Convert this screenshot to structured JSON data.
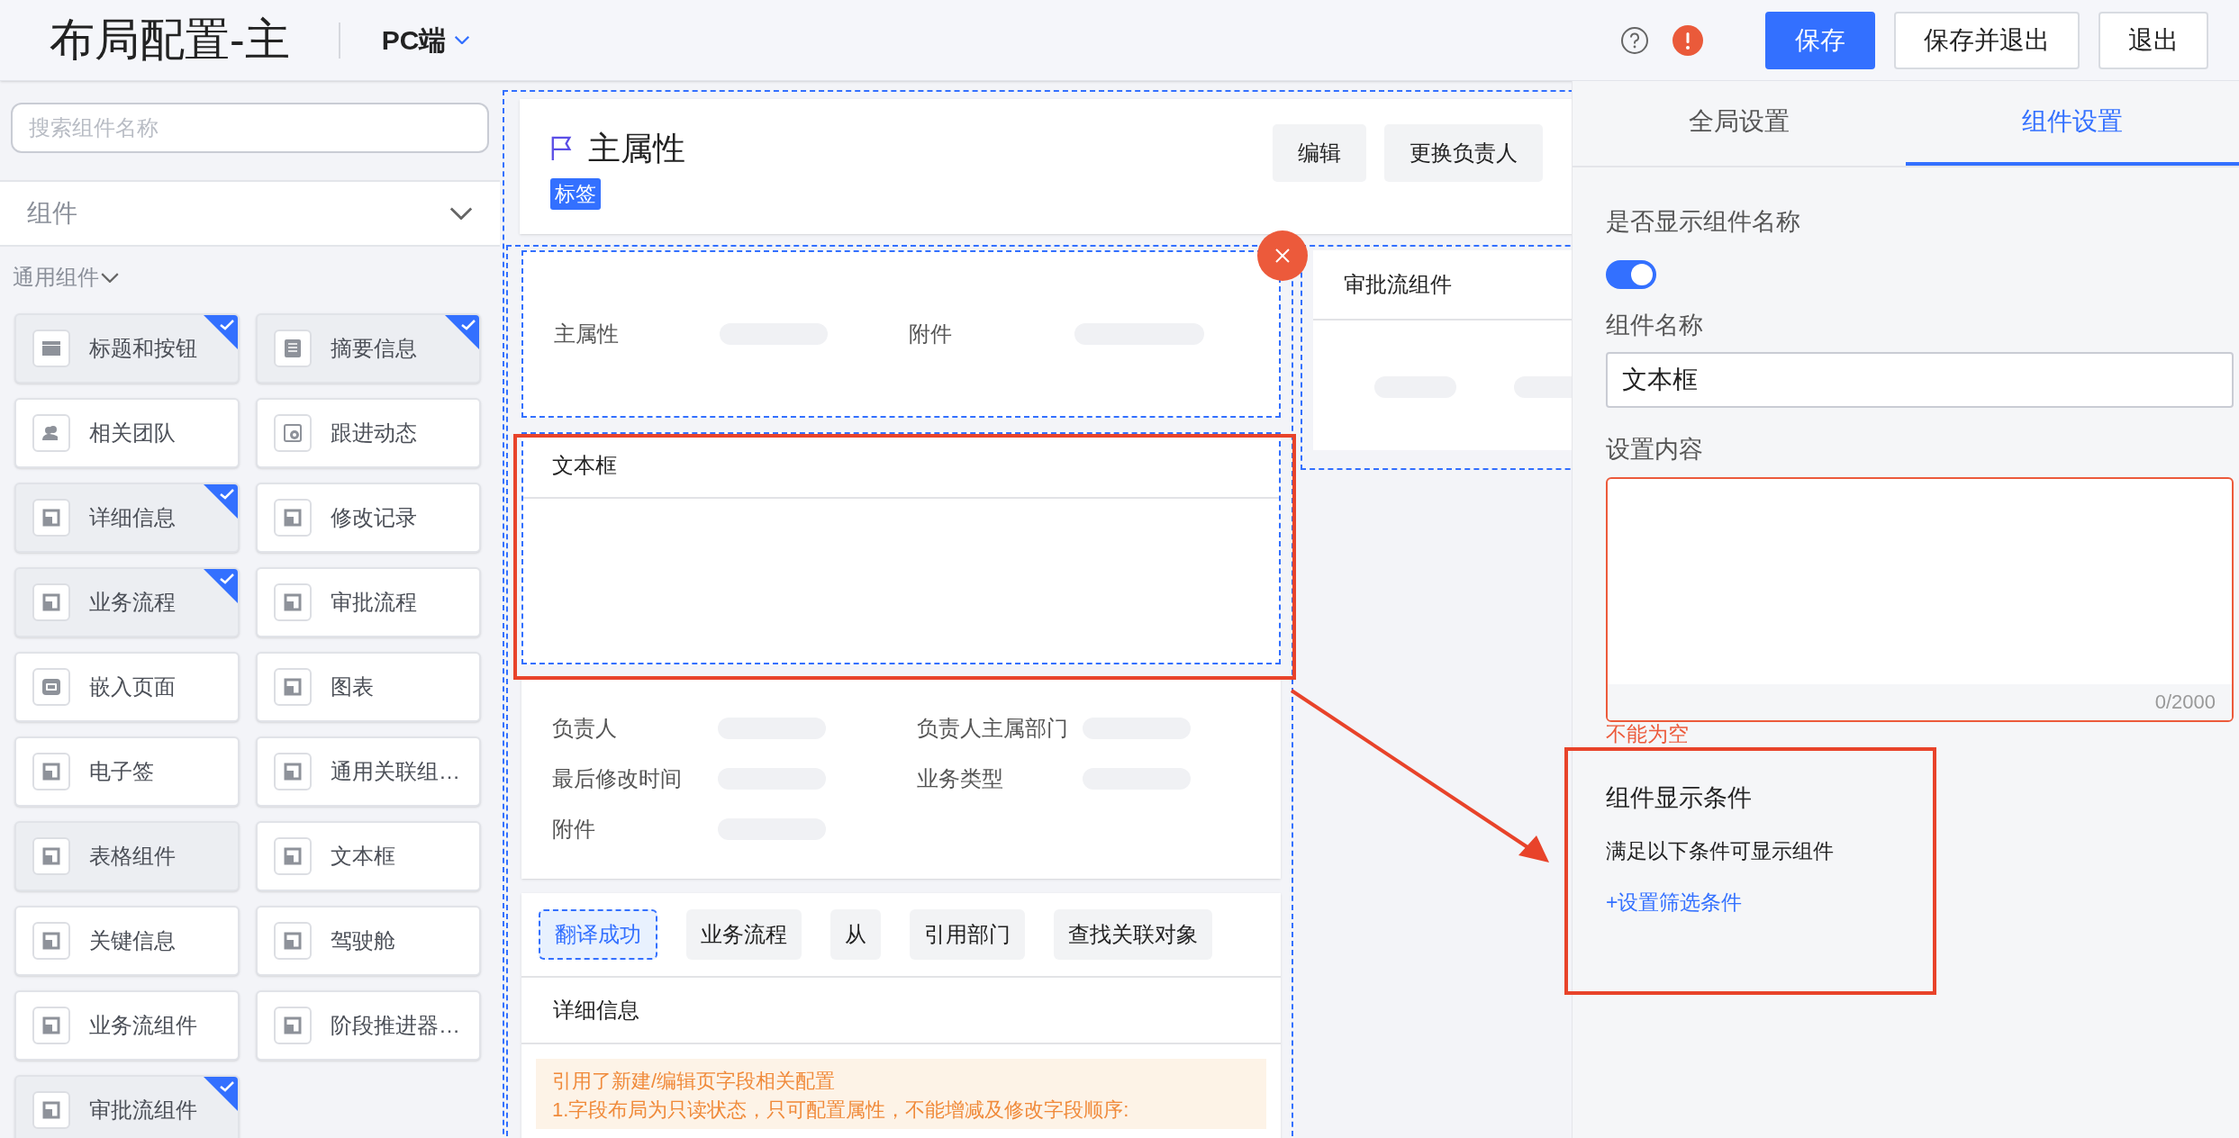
{
  "header": {
    "title": "布局配置-主",
    "platform": "PC端",
    "buttons": [
      {
        "label": "保存",
        "primary": true
      },
      {
        "label": "保存并退出",
        "primary": false
      },
      {
        "label": "退出",
        "primary": false
      }
    ]
  },
  "left_panel": {
    "search": {
      "placeholder": "搜索组件名称"
    },
    "category": "组件",
    "group": "通用组件",
    "components": [
      {
        "label": "标题和按钮",
        "kind": "titlebar",
        "added": true,
        "disabled": false
      },
      {
        "label": "摘要信息",
        "kind": "summary",
        "added": true,
        "disabled": false
      },
      {
        "label": "相关团队",
        "kind": "team",
        "added": false,
        "disabled": false
      },
      {
        "label": "跟进动态",
        "kind": "dynamic",
        "added": false,
        "disabled": false
      },
      {
        "label": "详细信息",
        "kind": "module",
        "added": true,
        "disabled": false
      },
      {
        "label": "修改记录",
        "kind": "module",
        "added": false,
        "disabled": false
      },
      {
        "label": "业务流程",
        "kind": "module",
        "added": true,
        "disabled": false
      },
      {
        "label": "审批流程",
        "kind": "module",
        "added": false,
        "disabled": false
      },
      {
        "label": "嵌入页面",
        "kind": "embed",
        "added": false,
        "disabled": false
      },
      {
        "label": "图表",
        "kind": "module",
        "added": false,
        "disabled": false
      },
      {
        "label": "电子签",
        "kind": "module",
        "added": false,
        "disabled": false
      },
      {
        "label": "通用关联组…",
        "kind": "module",
        "added": false,
        "disabled": false
      },
      {
        "label": "表格组件",
        "kind": "module",
        "added": false,
        "disabled": true
      },
      {
        "label": "文本框",
        "kind": "module",
        "added": false,
        "disabled": false
      },
      {
        "label": "关键信息",
        "kind": "module",
        "added": false,
        "disabled": false
      },
      {
        "label": "驾驶舱",
        "kind": "module",
        "added": false,
        "disabled": false
      },
      {
        "label": "业务流组件",
        "kind": "module",
        "added": false,
        "disabled": false
      },
      {
        "label": "阶段推进器…",
        "kind": "module",
        "added": false,
        "disabled": false
      },
      {
        "label": "审批流组件",
        "kind": "module",
        "added": true,
        "disabled": false
      }
    ]
  },
  "canvas": {
    "header_card": {
      "title": "主属性",
      "tag": "标签",
      "buttons": [
        "编辑",
        "更换负责人"
      ]
    },
    "main_card": {
      "fields": [
        "主属性",
        "附件"
      ]
    },
    "textbox_card": {
      "title": "文本框"
    },
    "fields_card": {
      "fields": [
        "负责人",
        "负责人主属部门",
        "最后修改时间",
        "业务类型",
        "附件"
      ]
    },
    "tabs_card": {
      "tabs": [
        {
          "label": "翻译成功",
          "selected": true
        },
        {
          "label": "业务流程",
          "selected": false
        },
        {
          "label": "从",
          "selected": false
        },
        {
          "label": "引用部门",
          "selected": false
        },
        {
          "label": "查找关联对象",
          "selected": false
        }
      ],
      "section": "详细信息",
      "notice": [
        "引用了新建/编辑页字段相关配置",
        "1.字段布局为只读状态，只可配置属性，不能增减及修改字段顺序:"
      ]
    },
    "side_card": {
      "title": "审批流组件"
    }
  },
  "right_panel": {
    "tabs": [
      {
        "label": "全局设置",
        "selected": false
      },
      {
        "label": "组件设置",
        "selected": true
      }
    ],
    "show_name_label": "是否显示组件名称",
    "show_name": true,
    "name_label": "组件名称",
    "name_value": "文本框",
    "content_label": "设置内容",
    "content_counter": "0/2000",
    "content_error": "不能为空",
    "condition_title": "组件显示条件",
    "condition_desc": "满足以下条件可显示组件",
    "condition_link": "+设置筛选条件"
  }
}
